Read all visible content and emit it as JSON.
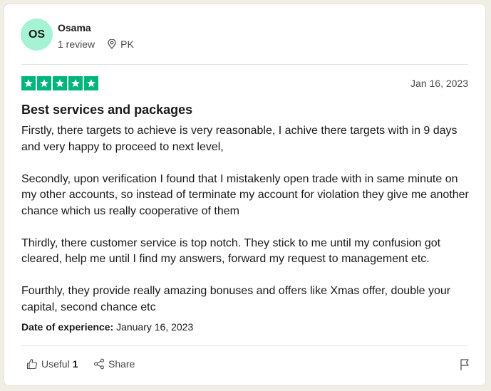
{
  "reviewer": {
    "initials": "OS",
    "name": "Osama",
    "reviews": "1 review",
    "country": "PK",
    "avatar_color": "#a6f2d4"
  },
  "rating": {
    "stars": 5,
    "max": 5,
    "color": "#00b67a"
  },
  "review": {
    "date": "Jan 16, 2023",
    "title": "Best services and packages",
    "paragraphs": [
      "Firstly, there targets to achieve is very reasonable, I achive there targets with in 9 days and very happy to proceed to next level,",
      "Secondly, upon verification I found that I mistakenly open trade with in same minute on my other accounts, so instead of terminate my account for violation they give me another chance which us really cooperative of them",
      "Thirdly, there customer service is top notch. They stick to me until my confusion got cleared, help me until I find my answers, forward my request to management etc.",
      "Fourthly, they provide really amazing bonuses and offers like Xmas offer, double your capital, second chance etc"
    ],
    "experience_label": "Date of experience:",
    "experience_date": "January 16, 2023"
  },
  "actions": {
    "useful_label": "Useful",
    "useful_count": "1",
    "share_label": "Share"
  },
  "icons": {
    "location": "location-pin-icon",
    "star": "star-icon",
    "useful": "thumbs-up-icon",
    "share": "share-icon",
    "flag": "flag-icon"
  }
}
